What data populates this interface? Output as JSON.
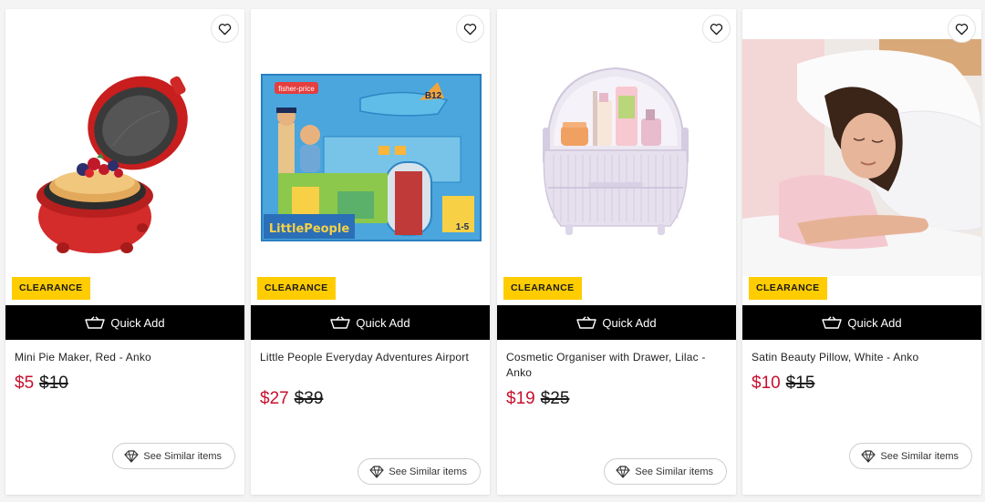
{
  "badge_label": "CLEARANCE",
  "quick_add_label": "Quick Add",
  "see_similar_label": "See Similar items",
  "colors": {
    "sale_red": "#c8102e",
    "badge_yellow": "#ffcc00",
    "quick_add_bg": "#000000"
  },
  "products": [
    {
      "title": "Mini Pie Maker, Red - Anko",
      "price": "$5",
      "was_price": "$10"
    },
    {
      "title": "Little People Everyday Adventures Airport",
      "price": "$27",
      "was_price": "$39"
    },
    {
      "title": "Cosmetic Organiser with Drawer, Lilac - Anko",
      "price": "$19",
      "was_price": "$25"
    },
    {
      "title": "Satin Beauty Pillow, White - Anko",
      "price": "$10",
      "was_price": "$15"
    }
  ],
  "image_text": {
    "brand_logo": "fisher-price",
    "little_people": "LittlePeople",
    "gate": "B12",
    "age": "1-5"
  }
}
